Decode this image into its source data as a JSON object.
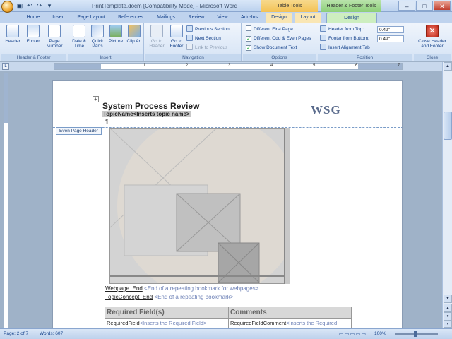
{
  "window": {
    "title": "PrintTemplate.docm [Compatibility Mode] - Microsoft Word",
    "context_table_tools": "Table Tools",
    "context_hf_tools": "Header & Footer Tools",
    "controls": {
      "minimize": "–",
      "maximize": "□",
      "close": "✕"
    }
  },
  "tabs": [
    {
      "label": "Home"
    },
    {
      "label": "Insert"
    },
    {
      "label": "Page Layout"
    },
    {
      "label": "References"
    },
    {
      "label": "Mailings"
    },
    {
      "label": "Review"
    },
    {
      "label": "View"
    },
    {
      "label": "Add-Ins"
    },
    {
      "label": "Design"
    },
    {
      "label": "Layout"
    },
    {
      "label": "Design"
    }
  ],
  "ribbon": {
    "groups": {
      "header_footer": "Header & Footer",
      "insert": "Insert",
      "navigation": "Navigation",
      "options": "Options",
      "position": "Position",
      "close": "Close"
    },
    "buttons": {
      "header": "Header",
      "footer": "Footer",
      "page_number": "Page Number",
      "date_time": "Date & Time",
      "quick_parts": "Quick Parts",
      "picture": "Picture",
      "clip_art": "Clip Art",
      "go_to_header": "Go to Header",
      "go_to_footer": "Go to Footer",
      "previous_section": "Previous Section",
      "next_section": "Next Section",
      "link_to_previous": "Link to Previous",
      "close_hf": "Close Header and Footer"
    },
    "options": {
      "different_first_page": {
        "label": "Different First Page",
        "checked": false
      },
      "different_odd_even": {
        "label": "Different Odd & Even Pages",
        "checked": true
      },
      "show_document_text": {
        "label": "Show Document Text",
        "checked": true
      }
    },
    "position": {
      "header_from_top_label": "Header from Top:",
      "header_from_top_value": "0.49\"",
      "footer_from_bottom_label": "Footer from Bottom:",
      "footer_from_bottom_value": "0.49\"",
      "insert_alignment_tab": "Insert Alignment Tab"
    }
  },
  "ruler": {
    "numbers": [
      "1",
      "2",
      "3",
      "4",
      "5",
      "6",
      "7"
    ]
  },
  "document": {
    "header": {
      "title": "System Process Review",
      "topic": "TopicName<Inserts topic name>",
      "logo": "WSG",
      "tag": "Even Page Header"
    },
    "pilcrow": "¶",
    "lines": {
      "webpage_end_a": "Webpage_End",
      "webpage_end_b": "<End of a repeating bookmark for webpages>",
      "topic_concept_a": "TopicConcept_End",
      "topic_concept_b": "<End of a repeating bookmark>"
    },
    "table": {
      "headers": [
        "Required Field(s)",
        "Comments"
      ],
      "row1": {
        "c1a": "RequiredField",
        "c1b": "<Inserts the Required Field>",
        "c2a": "RequiredFieldComment",
        "c2b": "<Inserts the Required"
      }
    }
  },
  "status": {
    "page": "Page: 2 of 7",
    "words": "Words: 607",
    "zoom": "100%"
  }
}
